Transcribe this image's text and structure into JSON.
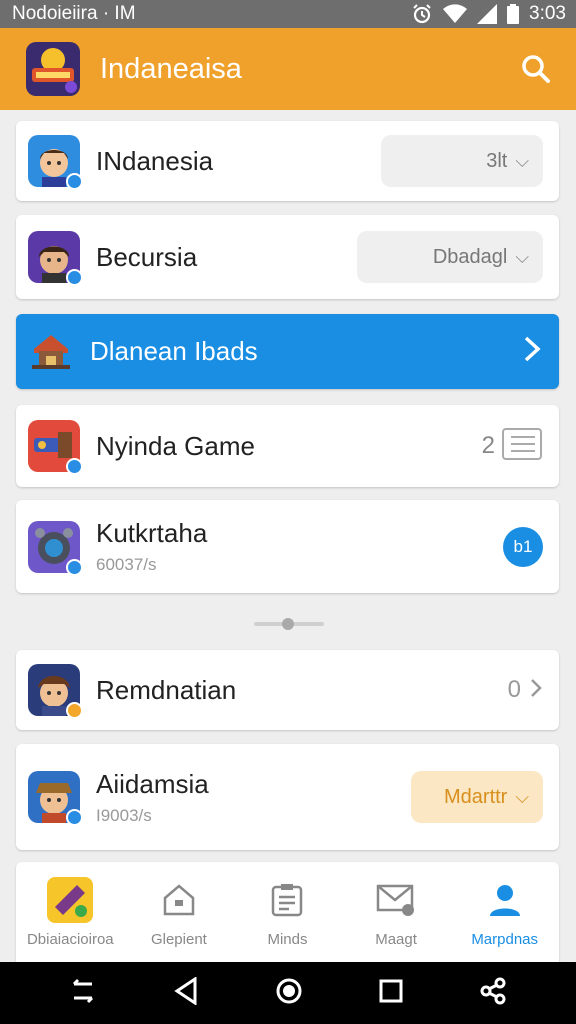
{
  "status_bar": {
    "left_text": "Nodoieiira · IM",
    "time": "3:03"
  },
  "app_bar": {
    "title": "Indaneaisa"
  },
  "items": [
    {
      "title": "INdanesia",
      "dropdown": "3lt",
      "avatar_bg": "#2f8de0",
      "badge_color": "#2a8de4"
    },
    {
      "title": "Becursia",
      "dropdown": "Dbadagl",
      "avatar_bg": "#5b3aa8",
      "badge_color": "#2a8de4"
    },
    {
      "title": "Dlanean Ibads",
      "accent": "#1a8ee3"
    },
    {
      "title": "Nyinda Game",
      "count": "2",
      "avatar_bg": "#e24a3b",
      "badge_color": "#2a8de4"
    },
    {
      "title": "Kutkrtaha",
      "subtitle": "60037/s",
      "circle_label": "b1",
      "avatar_bg": "#6e58c9",
      "badge_color": "#2a8de4"
    },
    {
      "title": "Remdnatian",
      "count": "0",
      "avatar_bg": "#2a3d7a",
      "badge_color": "#f2a62a"
    },
    {
      "title": "Aiidamsia",
      "subtitle": "I9003/s",
      "dropdown": "Mdarttr",
      "dropdown_bg": "#fbe7c3",
      "dropdown_color": "#d98f1d",
      "avatar_bg": "#2f6fc4",
      "badge_color": "#2a8de4"
    }
  ],
  "bottom_nav": [
    {
      "label": "Dbiaiacioiroa",
      "icon": "game-icon"
    },
    {
      "label": "Glepient",
      "icon": "home-icon"
    },
    {
      "label": "Minds",
      "icon": "clipboard-icon"
    },
    {
      "label": "Maagt",
      "icon": "mail-icon"
    },
    {
      "label": "Marpdnas",
      "icon": "profile-icon",
      "active": true
    }
  ],
  "colors": {
    "app_bar": "#f0a12b",
    "primary": "#1a8ee3",
    "status_bar": "#6e6e6e"
  }
}
